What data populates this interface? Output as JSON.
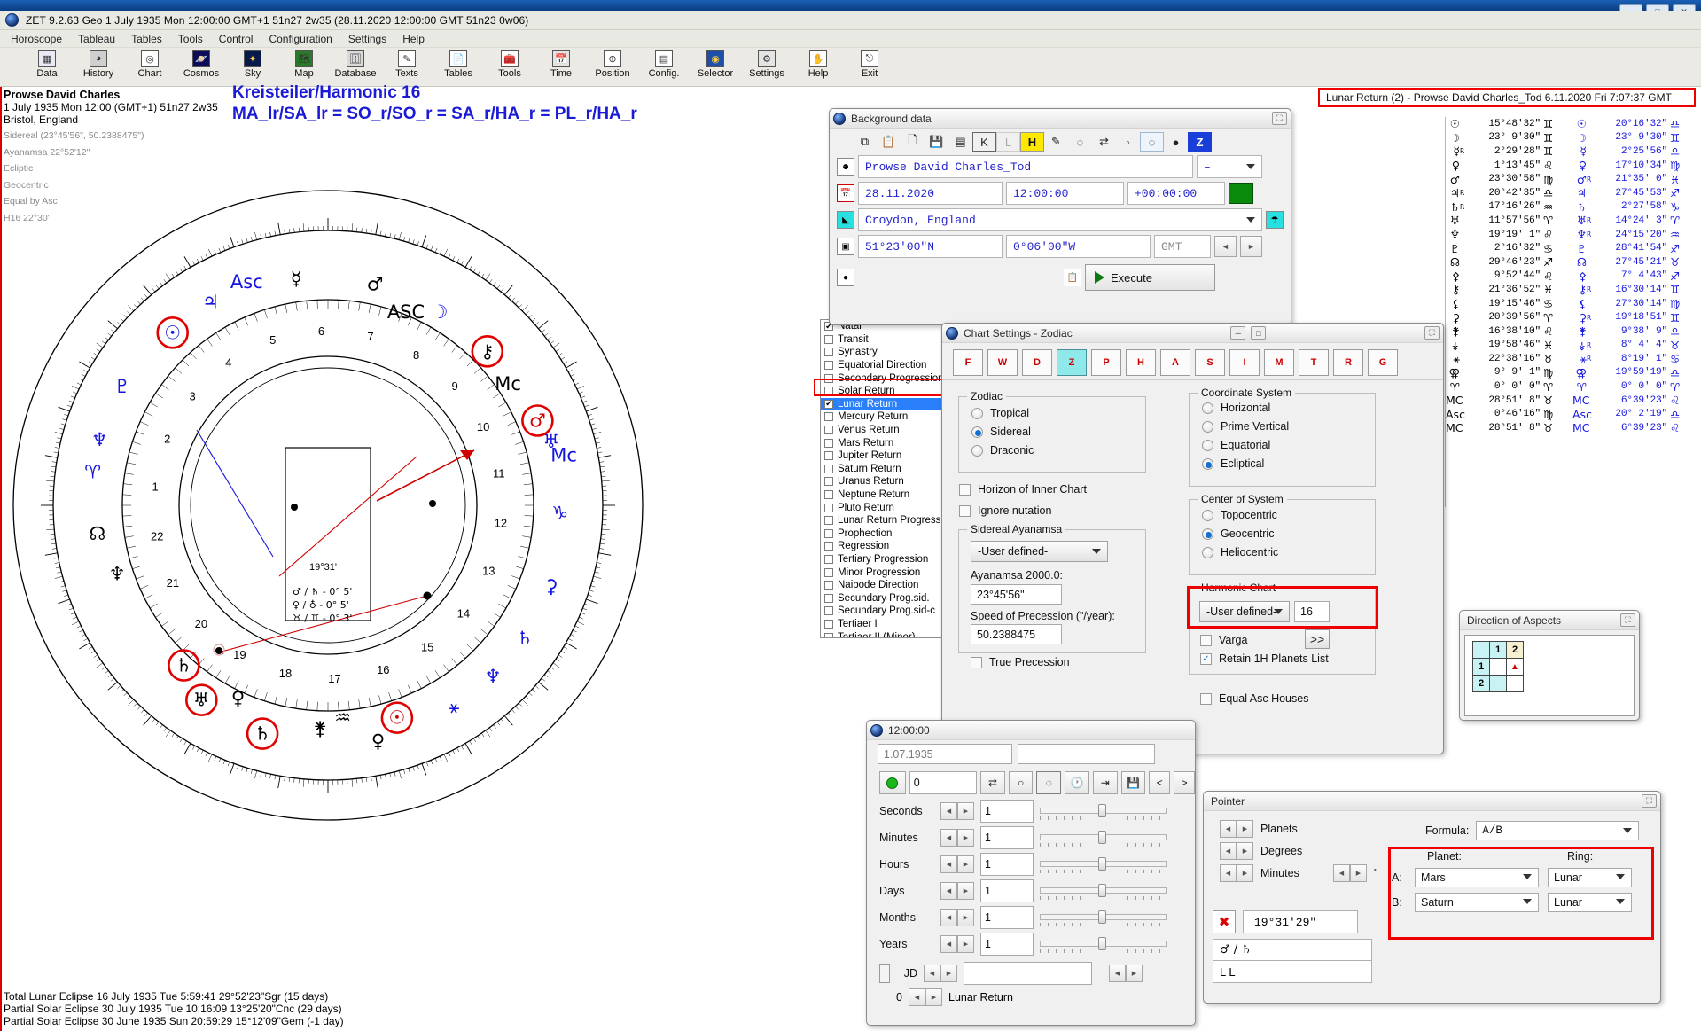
{
  "window": {
    "titlebar_buttons": [
      "—",
      "□",
      "✕"
    ]
  },
  "app": {
    "logo_icon": "zet-globe-icon",
    "status_line": "ZET 9.2.63 Geo   1 July 1935  Mon  12:00:00 GMT+1 51n27  2w35  (28.11.2020  12:00:00 GMT 51n23 0w06)"
  },
  "menubar": {
    "items": [
      "Horoscope",
      "Tableau",
      "Tables",
      "Tools",
      "Control",
      "Configuration",
      "Settings",
      "Help"
    ]
  },
  "toolbar": {
    "buttons": [
      {
        "label": "Data",
        "icon": "grid-table-icon"
      },
      {
        "label": "History",
        "icon": "clock-history-icon"
      },
      {
        "label": "Chart",
        "icon": "chart-wheel-icon"
      },
      {
        "label": "Cosmos",
        "icon": "planet-icon"
      },
      {
        "label": "Sky",
        "icon": "starfield-icon"
      },
      {
        "label": "Map",
        "icon": "world-map-icon"
      },
      {
        "label": "Database",
        "icon": "database-icon"
      },
      {
        "label": "Texts",
        "icon": "pen-icon"
      },
      {
        "label": "Tables",
        "icon": "document-icon"
      },
      {
        "label": "Tools",
        "icon": "toolbox-icon"
      },
      {
        "label": "Time",
        "icon": "calendar-icon"
      },
      {
        "label": "Position",
        "icon": "position-icon"
      },
      {
        "label": "Config.",
        "icon": "config-icon"
      },
      {
        "label": "Selector",
        "icon": "selector-icon"
      },
      {
        "label": "Settings",
        "icon": "gear-icon"
      },
      {
        "label": "Help",
        "icon": "help-hand-icon"
      },
      {
        "label": "Exit",
        "icon": "exit-door-icon"
      }
    ]
  },
  "chart_header": {
    "name": "Prowse David Charles",
    "datetime": "1 July 1935  Mon  12:00 (GMT+1) 51n27  2w35",
    "place": "Bristol, England",
    "sidereal": "Sidereal (23°45'56\", 50.2388475\")",
    "ayanamsa": "Ayanamsa 22°52'12\"",
    "ecliptic": "Ecliptic",
    "geocentric": "Geocentric",
    "houses": "Equal by Asc",
    "harmonic": "H16  22°30'"
  },
  "harmonic_banner": {
    "title": "Kreisteiler/Harmonic 16",
    "formula": "MA_lr/SA_lr = SO_r/SO_r = SA_r/HA_r = PL_r/HA_r"
  },
  "lunar_return_title": "Lunar Return (2) - Prowse David Charles_Tod  6.11.2020  Fri  7:07:37 GMT",
  "wheel": {
    "center_label": "19°31'",
    "inner_rows": [
      "♂ / ♄ - 0° 5'",
      "♀ / ♁ - 0° 5'",
      "♉ / ♊ - 0° 3'"
    ],
    "house_numbers": [
      "1",
      "2",
      "3",
      "4",
      "5",
      "6",
      "7",
      "8",
      "9",
      "10",
      "11",
      "12",
      "13",
      "14",
      "15",
      "16",
      "17",
      "18",
      "19",
      "20",
      "21",
      "22"
    ]
  },
  "background_data": {
    "title": "Background data",
    "toolbar_icons": [
      "copy-icon",
      "paste-icon",
      "new-doc-icon",
      "save-icon",
      "calendar-icon",
      "kepler-icon",
      "local-icon",
      "harmonic-h-icon",
      "pen-icon",
      "circle-outline-icon",
      "swap-icon",
      "small-circle-icon",
      "dotted-circle-icon",
      "filled-circle-icon",
      "zet-z-icon"
    ],
    "name_field": "Prowse David Charles_Tod",
    "name_dropdown": "–",
    "date_field": "28.11.2020",
    "time_field": "12:00:00",
    "zone_field": "+00:00:00",
    "zone_color_swatch": "#0a8a0a",
    "place_field": "Croydon, England",
    "lat_field": "51°23'00\"N",
    "lon_field": "0°06'00\"W",
    "gmt_field": "GMT",
    "execute_label": "Execute",
    "nav_prev": "◄",
    "nav_next": "►"
  },
  "chart_types": {
    "items": [
      {
        "label": "Natal",
        "checked": true,
        "selected": false
      },
      {
        "label": "Transit",
        "checked": false,
        "selected": false
      },
      {
        "label": "Synastry",
        "checked": false,
        "selected": false
      },
      {
        "label": "Equatorial Direction",
        "checked": false,
        "selected": false
      },
      {
        "label": "Secondary Progression",
        "checked": false,
        "selected": false
      },
      {
        "label": "Solar Return",
        "checked": false,
        "selected": false
      },
      {
        "label": "Lunar Return",
        "checked": true,
        "selected": true
      },
      {
        "label": "Mercury Return",
        "checked": false,
        "selected": false
      },
      {
        "label": "Venus Return",
        "checked": false,
        "selected": false
      },
      {
        "label": "Mars Return",
        "checked": false,
        "selected": false
      },
      {
        "label": "Jupiter Return",
        "checked": false,
        "selected": false
      },
      {
        "label": "Saturn Return",
        "checked": false,
        "selected": false
      },
      {
        "label": "Uranus Return",
        "checked": false,
        "selected": false
      },
      {
        "label": "Neptune Return",
        "checked": false,
        "selected": false
      },
      {
        "label": "Pluto Return",
        "checked": false,
        "selected": false
      },
      {
        "label": "Lunar Return Progress",
        "checked": false,
        "selected": false
      },
      {
        "label": "Prophection",
        "checked": false,
        "selected": false
      },
      {
        "label": "Regression",
        "checked": false,
        "selected": false
      },
      {
        "label": "Tertiary Progression",
        "checked": false,
        "selected": false
      },
      {
        "label": "Minor Progression",
        "checked": false,
        "selected": false
      },
      {
        "label": "Naibode Direction",
        "checked": false,
        "selected": false
      },
      {
        "label": "Secundary Prog.sid.",
        "checked": false,
        "selected": false
      },
      {
        "label": "Secundary Prog.sid-c",
        "checked": false,
        "selected": false
      },
      {
        "label": "Tertiaer I",
        "checked": false,
        "selected": false
      },
      {
        "label": "Tertiaer II (Minor)",
        "checked": false,
        "selected": false
      }
    ]
  },
  "chart_settings": {
    "title": "Chart Settings - Zodiac",
    "tabs": [
      {
        "name": "tab-F",
        "letter": "F",
        "active": false
      },
      {
        "name": "tab-W",
        "letter": "W",
        "active": false
      },
      {
        "name": "tab-D",
        "letter": "D",
        "active": false
      },
      {
        "name": "tab-Z",
        "letter": "Z",
        "active": true
      },
      {
        "name": "tab-P",
        "letter": "P",
        "active": false
      },
      {
        "name": "tab-H",
        "letter": "H",
        "active": false
      },
      {
        "name": "tab-A",
        "letter": "A",
        "active": false
      },
      {
        "name": "tab-S",
        "letter": "S",
        "active": false
      },
      {
        "name": "tab-I",
        "letter": "I",
        "active": false
      },
      {
        "name": "tab-M",
        "letter": "M",
        "active": false
      },
      {
        "name": "tab-T",
        "letter": "T",
        "active": false
      },
      {
        "name": "tab-R",
        "letter": "R",
        "active": false
      },
      {
        "name": "tab-G",
        "letter": "G",
        "active": false
      }
    ],
    "zodiac": {
      "group_label": "Zodiac",
      "options": [
        {
          "label": "Tropical",
          "selected": false
        },
        {
          "label": "Sidereal",
          "selected": true
        },
        {
          "label": "Draconic",
          "selected": false
        }
      ]
    },
    "horizon_inner_chart": {
      "label": "Horizon of Inner Chart",
      "checked": false
    },
    "ignore_nutation": {
      "label": "Ignore nutation",
      "checked": false
    },
    "sidereal_ayanamsa": {
      "group_label": "Sidereal Ayanamsa",
      "preset": "-User defined-",
      "ayanamsa_label": "Ayanamsa 2000.0:",
      "ayanamsa_value": "23°45'56\"",
      "precession_label": "Speed of Precession (\"/year):",
      "precession_value": "50.2388475",
      "true_precession": {
        "label": "True Precession",
        "checked": false
      }
    },
    "coordinate_system": {
      "group_label": "Coordinate System",
      "options": [
        {
          "label": "Horizontal",
          "selected": false
        },
        {
          "label": "Prime Vertical",
          "selected": false
        },
        {
          "label": "Equatorial",
          "selected": false
        },
        {
          "label": "Ecliptical",
          "selected": true
        }
      ]
    },
    "center_of_system": {
      "group_label": "Center of System",
      "options": [
        {
          "label": "Topocentric",
          "selected": false
        },
        {
          "label": "Geocentric",
          "selected": true
        },
        {
          "label": "Heliocentric",
          "selected": false
        }
      ]
    },
    "harmonic_chart": {
      "group_label": "Harmonic Chart",
      "preset": "-User defined-",
      "value": "16",
      "varga": {
        "label": "Varga",
        "checked": false
      },
      "retain_1h": {
        "label": "Retain 1H Planets List",
        "checked": true
      },
      "equal_asc": {
        "label": "Equal Asc Houses",
        "checked": false
      },
      "more_button": ">>"
    }
  },
  "time_window": {
    "title": "12:00:00",
    "date_field": "1.07.1935",
    "step_value": "0",
    "toolbar_icons": [
      "green-dot-icon",
      "swap-icon",
      "small-circle-icon",
      "dotted-circle-icon",
      "clock-icon",
      "export-icon",
      "save-icon"
    ],
    "nav_prev": "<",
    "nav_next": ">",
    "rows": [
      {
        "label": "Seconds",
        "value": "1"
      },
      {
        "label": "Minutes",
        "value": "1"
      },
      {
        "label": "Hours",
        "value": "1"
      },
      {
        "label": "Days",
        "value": "1"
      },
      {
        "label": "Months",
        "value": "1"
      },
      {
        "label": "Years",
        "value": "1"
      }
    ],
    "jd_label": "JD",
    "jd_value": "",
    "bottom_count": "0",
    "bottom_label": "Lunar Return"
  },
  "pointer": {
    "title": "Pointer",
    "steppers": [
      {
        "label": "Planets"
      },
      {
        "label": "Degrees"
      },
      {
        "label": "Minutes"
      }
    ],
    "minutes_unit": "\"",
    "formula_label": "Formula:",
    "formula_value": "A/B",
    "planet_col_label": "Planet:",
    "ring_col_label": "Ring:",
    "rows": [
      {
        "key": "A:",
        "planet": "Mars",
        "ring": "Lunar"
      },
      {
        "key": "B:",
        "planet": "Saturn",
        "ring": "Lunar"
      }
    ],
    "value_field": "19°31'29\"",
    "value_icon": "aspect-cross-icon",
    "glyph_row": "♂ / ♄",
    "ring_row": "L   L"
  },
  "direction_of_aspects": {
    "title": "Direction of Aspects",
    "col_headers": [
      "1",
      "2"
    ],
    "row_headers": [
      "1",
      "2"
    ],
    "marked_cell": "1,2"
  },
  "planets_panel": {
    "left_column_color": "#000000",
    "right_column_color": "#1414e0",
    "rows": [
      {
        "a": {
          "glyph": "☉",
          "retro": "",
          "value": "15°48'32\"",
          "sign": "♊"
        },
        "b": {
          "glyph": "☉",
          "retro": "",
          "value": "20°16'32\"",
          "sign": "♎"
        }
      },
      {
        "a": {
          "glyph": "☽",
          "retro": "",
          "value": "23° 9'30\"",
          "sign": "♊"
        },
        "b": {
          "glyph": "☽",
          "retro": "",
          "value": "23° 9'30\"",
          "sign": "♊"
        }
      },
      {
        "a": {
          "glyph": "☿",
          "retro": "R",
          "value": "2°29'28\"",
          "sign": "♊"
        },
        "b": {
          "glyph": "☿",
          "retro": "",
          "value": "2°25'56\"",
          "sign": "♎"
        }
      },
      {
        "a": {
          "glyph": "♀",
          "retro": "",
          "value": "1°13'45\"",
          "sign": "♌"
        },
        "b": {
          "glyph": "♀",
          "retro": "",
          "value": "17°10'34\"",
          "sign": "♍"
        }
      },
      {
        "a": {
          "glyph": "♂",
          "retro": "",
          "value": "23°30'58\"",
          "sign": "♍"
        },
        "b": {
          "glyph": "♂",
          "retro": "R",
          "value": "21°35' 0\"",
          "sign": "♓"
        }
      },
      {
        "a": {
          "glyph": "♃",
          "retro": "R",
          "value": "20°42'35\"",
          "sign": "♎"
        },
        "b": {
          "glyph": "♃",
          "retro": "",
          "value": "27°45'53\"",
          "sign": "♐"
        }
      },
      {
        "a": {
          "glyph": "♄",
          "retro": "R",
          "value": "17°16'26\"",
          "sign": "♒"
        },
        "b": {
          "glyph": "♄",
          "retro": "",
          "value": "2°27'58\"",
          "sign": "♑"
        }
      },
      {
        "a": {
          "glyph": "♅",
          "retro": "",
          "value": "11°57'56\"",
          "sign": "♈"
        },
        "b": {
          "glyph": "♅",
          "retro": "R",
          "value": "14°24' 3\"",
          "sign": "♈"
        }
      },
      {
        "a": {
          "glyph": "♆",
          "retro": "",
          "value": "19°19' 1\"",
          "sign": "♌"
        },
        "b": {
          "glyph": "♆",
          "retro": "R",
          "value": "24°15'20\"",
          "sign": "♒"
        }
      },
      {
        "a": {
          "glyph": "♇",
          "retro": "",
          "value": "2°16'32\"",
          "sign": "♋"
        },
        "b": {
          "glyph": "♇",
          "retro": "",
          "value": "28°41'54\"",
          "sign": "♐"
        }
      },
      {
        "a": {
          "glyph": "☊",
          "retro": "",
          "value": "29°46'23\"",
          "sign": "♐"
        },
        "b": {
          "glyph": "☊",
          "retro": "",
          "value": "27°45'21\"",
          "sign": "♉"
        }
      },
      {
        "a": {
          "glyph": "⚴",
          "retro": "",
          "value": "9°52'44\"",
          "sign": "♌"
        },
        "b": {
          "glyph": "⚴",
          "retro": "",
          "value": "7° 4'43\"",
          "sign": "♐"
        }
      },
      {
        "a": {
          "glyph": "⚷",
          "retro": "",
          "value": "21°36'52\"",
          "sign": "♓"
        },
        "b": {
          "glyph": "⚷",
          "retro": "R",
          "value": "16°30'14\"",
          "sign": "♊"
        }
      },
      {
        "a": {
          "glyph": "⚸",
          "retro": "",
          "value": "19°15'46\"",
          "sign": "♋"
        },
        "b": {
          "glyph": "⚸",
          "retro": "",
          "value": "27°30'14\"",
          "sign": "♍"
        }
      },
      {
        "a": {
          "glyph": "⚳",
          "retro": "",
          "value": "20°39'56\"",
          "sign": "♈"
        },
        "b": {
          "glyph": "⚳",
          "retro": "R",
          "value": "19°18'51\"",
          "sign": "♊"
        }
      },
      {
        "a": {
          "glyph": "⚵",
          "retro": "",
          "value": "16°38'10\"",
          "sign": "♌"
        },
        "b": {
          "glyph": "⚵",
          "retro": "",
          "value": "9°38' 9\"",
          "sign": "♎"
        }
      },
      {
        "a": {
          "glyph": "⚶",
          "retro": "",
          "value": "19°58'46\"",
          "sign": "♓"
        },
        "b": {
          "glyph": "⚶",
          "retro": "R",
          "value": "8° 4' 4\"",
          "sign": "♉"
        }
      },
      {
        "a": {
          "glyph": "⚹",
          "retro": "",
          "value": "22°38'16\"",
          "sign": "♉"
        },
        "b": {
          "glyph": "⚹",
          "retro": "R",
          "value": "8°19' 1\"",
          "sign": "♋"
        }
      },
      {
        "a": {
          "glyph": "⚢",
          "retro": "",
          "value": "9° 9' 1\"",
          "sign": "♍"
        },
        "b": {
          "glyph": "⚢",
          "retro": "",
          "value": "19°59'19\"",
          "sign": "♎"
        }
      },
      {
        "a": {
          "glyph": "♈",
          "retro": "",
          "value": "0° 0' 0\"",
          "sign": "♈"
        },
        "b": {
          "glyph": "♈",
          "retro": "",
          "value": "0° 0' 0\"",
          "sign": "♈"
        }
      },
      {
        "a": {
          "glyph": "MC",
          "retro": "",
          "value": "28°51' 8\"",
          "sign": "♉"
        },
        "b": {
          "glyph": "MC",
          "retro": "",
          "value": "6°39'23\"",
          "sign": "♌"
        }
      },
      {
        "a": {
          "glyph": "Asc",
          "retro": "",
          "value": "0°46'16\"",
          "sign": "♍"
        },
        "b": {
          "glyph": "Asc",
          "retro": "",
          "value": "20° 2'19\"",
          "sign": "♎"
        }
      },
      {
        "a": {
          "glyph": "MC",
          "retro": "",
          "value": "28°51' 8\"",
          "sign": "♉"
        },
        "b": {
          "glyph": "MC",
          "retro": "",
          "value": "6°39'23\"",
          "sign": "♌"
        }
      }
    ]
  },
  "eclipse_footer": {
    "lines": [
      "Total Lunar Eclipse 16 July 1935 Tue  5:59:41 29°52'23\"Sgr (15 days)",
      "Partial Solar Eclipse 30 July 1935 Tue 10:16:09 13°25'20\"Cnc (29 days)",
      "Partial Solar Eclipse 30 June 1935 Sun 20:59:29 15°12'09\"Gem (-1 day)"
    ]
  },
  "colors": {
    "accent_blue": "#1b1bd6",
    "highlight_red": "#ee0000",
    "selection_blue": "#2a7ffa",
    "title_blue": "#0b3d82"
  }
}
